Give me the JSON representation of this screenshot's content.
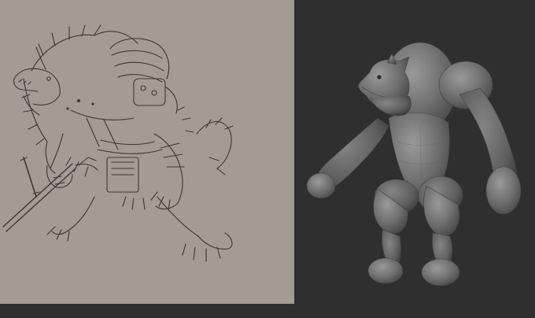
{
  "panels": {
    "sketch": {
      "subject": "werewolf-warrior-line-drawing",
      "background_color": "#a39c92",
      "line_color": "#3b3833"
    },
    "render": {
      "subject": "werewolf-3d-clay-blockout",
      "background_color": "#2f2f2f",
      "clay_color": "#7a7a7a"
    }
  }
}
